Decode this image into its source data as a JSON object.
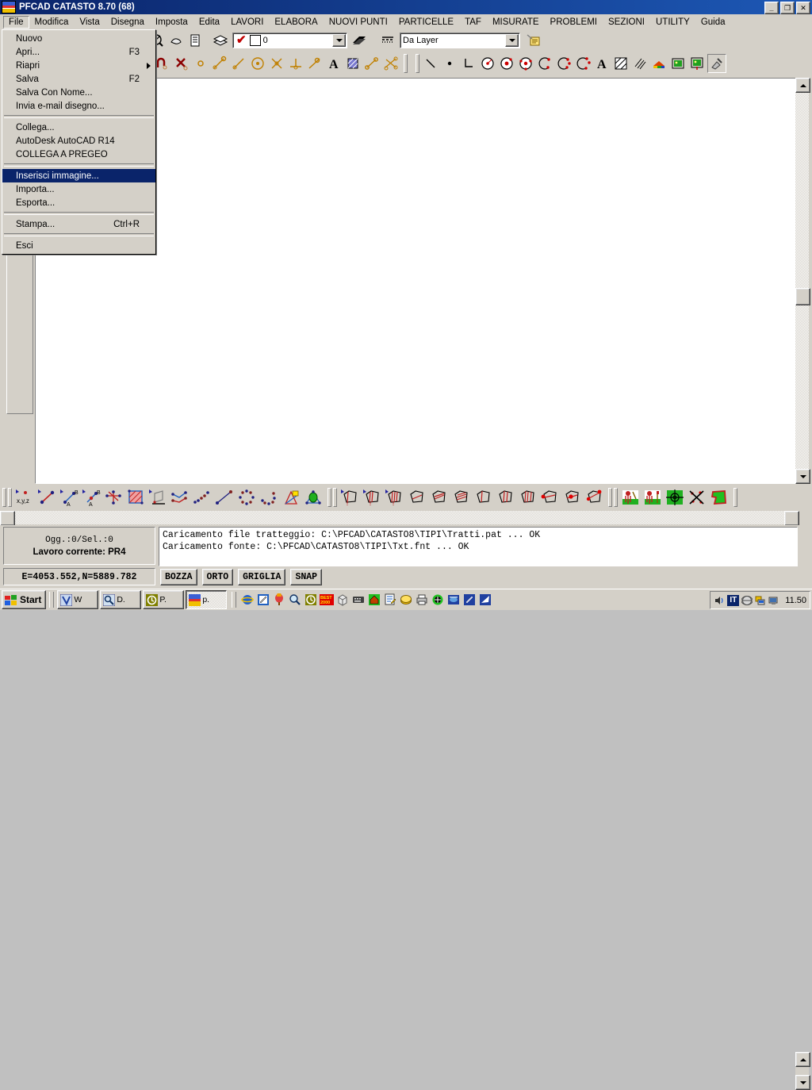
{
  "window": {
    "title": "PFCAD CATASTO 8.70 (68)",
    "icon": "app-icon",
    "buttons": {
      "minimize": "_",
      "maximize": "❐",
      "close": "✕"
    }
  },
  "menubar": {
    "items": [
      {
        "label": "File",
        "open": true
      },
      {
        "label": "Modifica"
      },
      {
        "label": "Vista"
      },
      {
        "label": "Disegna"
      },
      {
        "label": "Imposta"
      },
      {
        "label": "Edita"
      },
      {
        "label": "LAVORI"
      },
      {
        "label": "ELABORA"
      },
      {
        "label": "NUOVI PUNTI"
      },
      {
        "label": "PARTICELLE"
      },
      {
        "label": "TAF"
      },
      {
        "label": "MISURATE"
      },
      {
        "label": "PROBLEMI"
      },
      {
        "label": "SEZIONI"
      },
      {
        "label": "UTILITY"
      },
      {
        "label": "Guida"
      }
    ]
  },
  "file_menu": {
    "items": [
      {
        "label": "Nuovo",
        "accel": "",
        "submenu": false,
        "selected": false
      },
      {
        "label": "Apri...",
        "accel": "F3",
        "submenu": false,
        "selected": false
      },
      {
        "label": "Riapri",
        "accel": "",
        "submenu": true,
        "selected": false
      },
      {
        "label": "Salva",
        "accel": "F2",
        "submenu": false,
        "selected": false
      },
      {
        "label": "Salva Con Nome...",
        "accel": "",
        "submenu": false,
        "selected": false
      },
      {
        "label": "Invia e-mail disegno...",
        "accel": "",
        "submenu": false,
        "selected": false
      },
      {
        "separator": true
      },
      {
        "label": "Collega...",
        "accel": "",
        "submenu": false,
        "selected": false
      },
      {
        "label": "AutoDesk AutoCAD R14",
        "accel": "",
        "submenu": false,
        "selected": false
      },
      {
        "label": "COLLEGA A PREGEO",
        "accel": "",
        "submenu": false,
        "selected": false
      },
      {
        "separator": true
      },
      {
        "label": "Inserisci immagine...",
        "accel": "",
        "submenu": false,
        "selected": true
      },
      {
        "label": "Importa...",
        "accel": "",
        "submenu": false,
        "selected": false
      },
      {
        "label": "Esporta...",
        "accel": "",
        "submenu": false,
        "selected": false
      },
      {
        "separator": true
      },
      {
        "label": "Stampa...",
        "accel": "Ctrl+R",
        "submenu": false,
        "selected": false
      },
      {
        "separator": true
      },
      {
        "label": "Esci",
        "accel": "",
        "submenu": false,
        "selected": false
      }
    ]
  },
  "toolbar_main": {
    "layer_combo": {
      "value": "0",
      "check": "✔",
      "swatch_color": "#ffffff"
    },
    "linetype_combo": {
      "value": "Da Layer"
    },
    "icons": [
      "new-file-icon",
      "open-file-icon",
      "save-icon",
      "print-icon",
      "print-preview-icon",
      "cut-icon",
      "copy-icon",
      "paste-icon",
      "undo-icon",
      "redo-icon",
      "zoom-window-icon",
      "zoom-previous-icon",
      "pan-icon",
      "properties-icon",
      "layers-icon",
      "layer-state-icon",
      "linetype-icon",
      "note-icon"
    ]
  },
  "toolbar_snap": {
    "icons": [
      "osnap-icon",
      "snap-off-icon",
      "snap-node-icon",
      "snap-midpoint-icon",
      "snap-endpoint-icon",
      "snap-center-icon",
      "snap-intersection-icon",
      "snap-perpendicular-icon",
      "snap-nearest-icon",
      "snap-text-icon",
      "snap-hatch-icon",
      "snap-two-points-icon",
      "snap-multi-icon"
    ]
  },
  "toolbar_draw": {
    "icons": [
      "line-icon",
      "point-icon",
      "polyline-icon",
      "circle-radius-icon",
      "circle-center-icon",
      "circle-3points-icon",
      "arc-icon",
      "arc-2-icon",
      "arc-3-icon",
      "text-icon",
      "hatch-solid-icon",
      "hatch-lines-icon",
      "color-fill-icon",
      "image-insert-icon",
      "image-attach-icon",
      "wipeout-icon"
    ]
  },
  "toolbar_left": {
    "icons": [
      "polygon-select-icon",
      "pick-select-icon",
      "zigzag-icon",
      "points-cloud-icon",
      "arrow-diagonal-icon",
      "measure-icon",
      "pregeo-icon"
    ]
  },
  "toolbar_bottom_left": {
    "icons": [
      "xyz-point-icon",
      "line-2points-icon",
      "segment-ab-icon",
      "point-ab-icon",
      "star-points-icon",
      "filled-square-icon",
      "perspective-icon",
      "polyline-points-icon",
      "chain-points-icon",
      "line-points-icon",
      "circle-points-icon",
      "arc-points-icon",
      "triangle-yellow-icon",
      "green-node-icon"
    ]
  },
  "toolbar_bottom_mid": {
    "icons": [
      "parcel-split-1-icon",
      "parcel-split-2-icon",
      "parcel-split-3-icon",
      "parcel-line-1-icon",
      "parcel-line-2-icon",
      "parcel-line-3-icon",
      "parcel-strip-1-icon",
      "parcel-strip-2-icon",
      "parcel-strip-3-icon",
      "parcel-node-1-icon",
      "parcel-node-2-icon",
      "parcel-node-3-icon"
    ]
  },
  "toolbar_bottom_right": {
    "icons": [
      "surveyor-icon",
      "surveyor-pole-icon",
      "target-grid-icon",
      "cross-out-icon",
      "green-parcel-icon"
    ]
  },
  "status": {
    "objects_label": "Ogg.:0/Sel.:0",
    "current_job_label": "Lavoro corrente: PR4"
  },
  "command_output": {
    "lines": [
      "Caricamento file tratteggio: C:\\PFCAD\\CATASTO8\\TIPI\\Tratti.pat ... OK",
      "Caricamento fonte: C:\\PFCAD\\CATASTO8\\TIPI\\Txt.fnt ... OK"
    ]
  },
  "coordbar": {
    "coordinates": "E=4053.552,N=5889.782",
    "modes": [
      "BOZZA",
      "ORTO",
      "GRIGLIA",
      "SNAP"
    ]
  },
  "taskbar": {
    "start_label": "Start",
    "quicklaunch": [
      "ie-icon",
      "notepad-edit-icon",
      "balloon-icon",
      "search-icon",
      "clock-olive-icon",
      "best2000-icon",
      "package-icon",
      "keyboard-icon",
      "house-green-icon",
      "notes-icon",
      "yellow-disk-icon",
      "printer-icon",
      "checkered-globe-icon",
      "blue-book-icon",
      "pen-blue-icon",
      "flag-blue-icon"
    ],
    "tasks": [
      {
        "label": "W",
        "icon": "word-icon",
        "active": false
      },
      {
        "label": "D.",
        "icon": "search-doc-icon",
        "active": false
      },
      {
        "label": "P.",
        "icon": "clock-app-icon",
        "active": false
      },
      {
        "label": "p.",
        "icon": "pfcad-icon",
        "active": true
      }
    ],
    "tray": {
      "icons": [
        "volume-icon",
        "language-it-icon",
        "globe-icon",
        "network-icon",
        "display-icon"
      ],
      "language": "IT",
      "clock": "11.50"
    }
  },
  "colors": {
    "titlebar_start": "#0a246a",
    "titlebar_end": "#1d58b5",
    "face": "#d4d0c8",
    "highlight": "#0a246a",
    "canvas": "#ffffff"
  }
}
